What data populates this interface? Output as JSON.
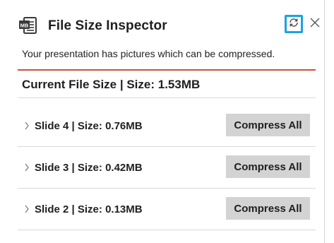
{
  "header": {
    "title": "File Size Inspector",
    "app_icon": "ppt-document-icon",
    "refresh_icon": "refresh-icon",
    "close_icon": "close-icon",
    "accent_color": "#1aa3df"
  },
  "subtitle": "Your presentation has pictures which can be compressed.",
  "summary": {
    "label": "Current File Size | Size: 1.53MB",
    "divider_color": "#c8523a"
  },
  "slides": [
    {
      "label": "Slide 4 | Size: 0.76MB",
      "button": "Compress All"
    },
    {
      "label": "Slide 3 | Size: 0.42MB",
      "button": "Compress All"
    },
    {
      "label": "Slide 2 | Size: 0.13MB",
      "button": "Compress All"
    }
  ]
}
